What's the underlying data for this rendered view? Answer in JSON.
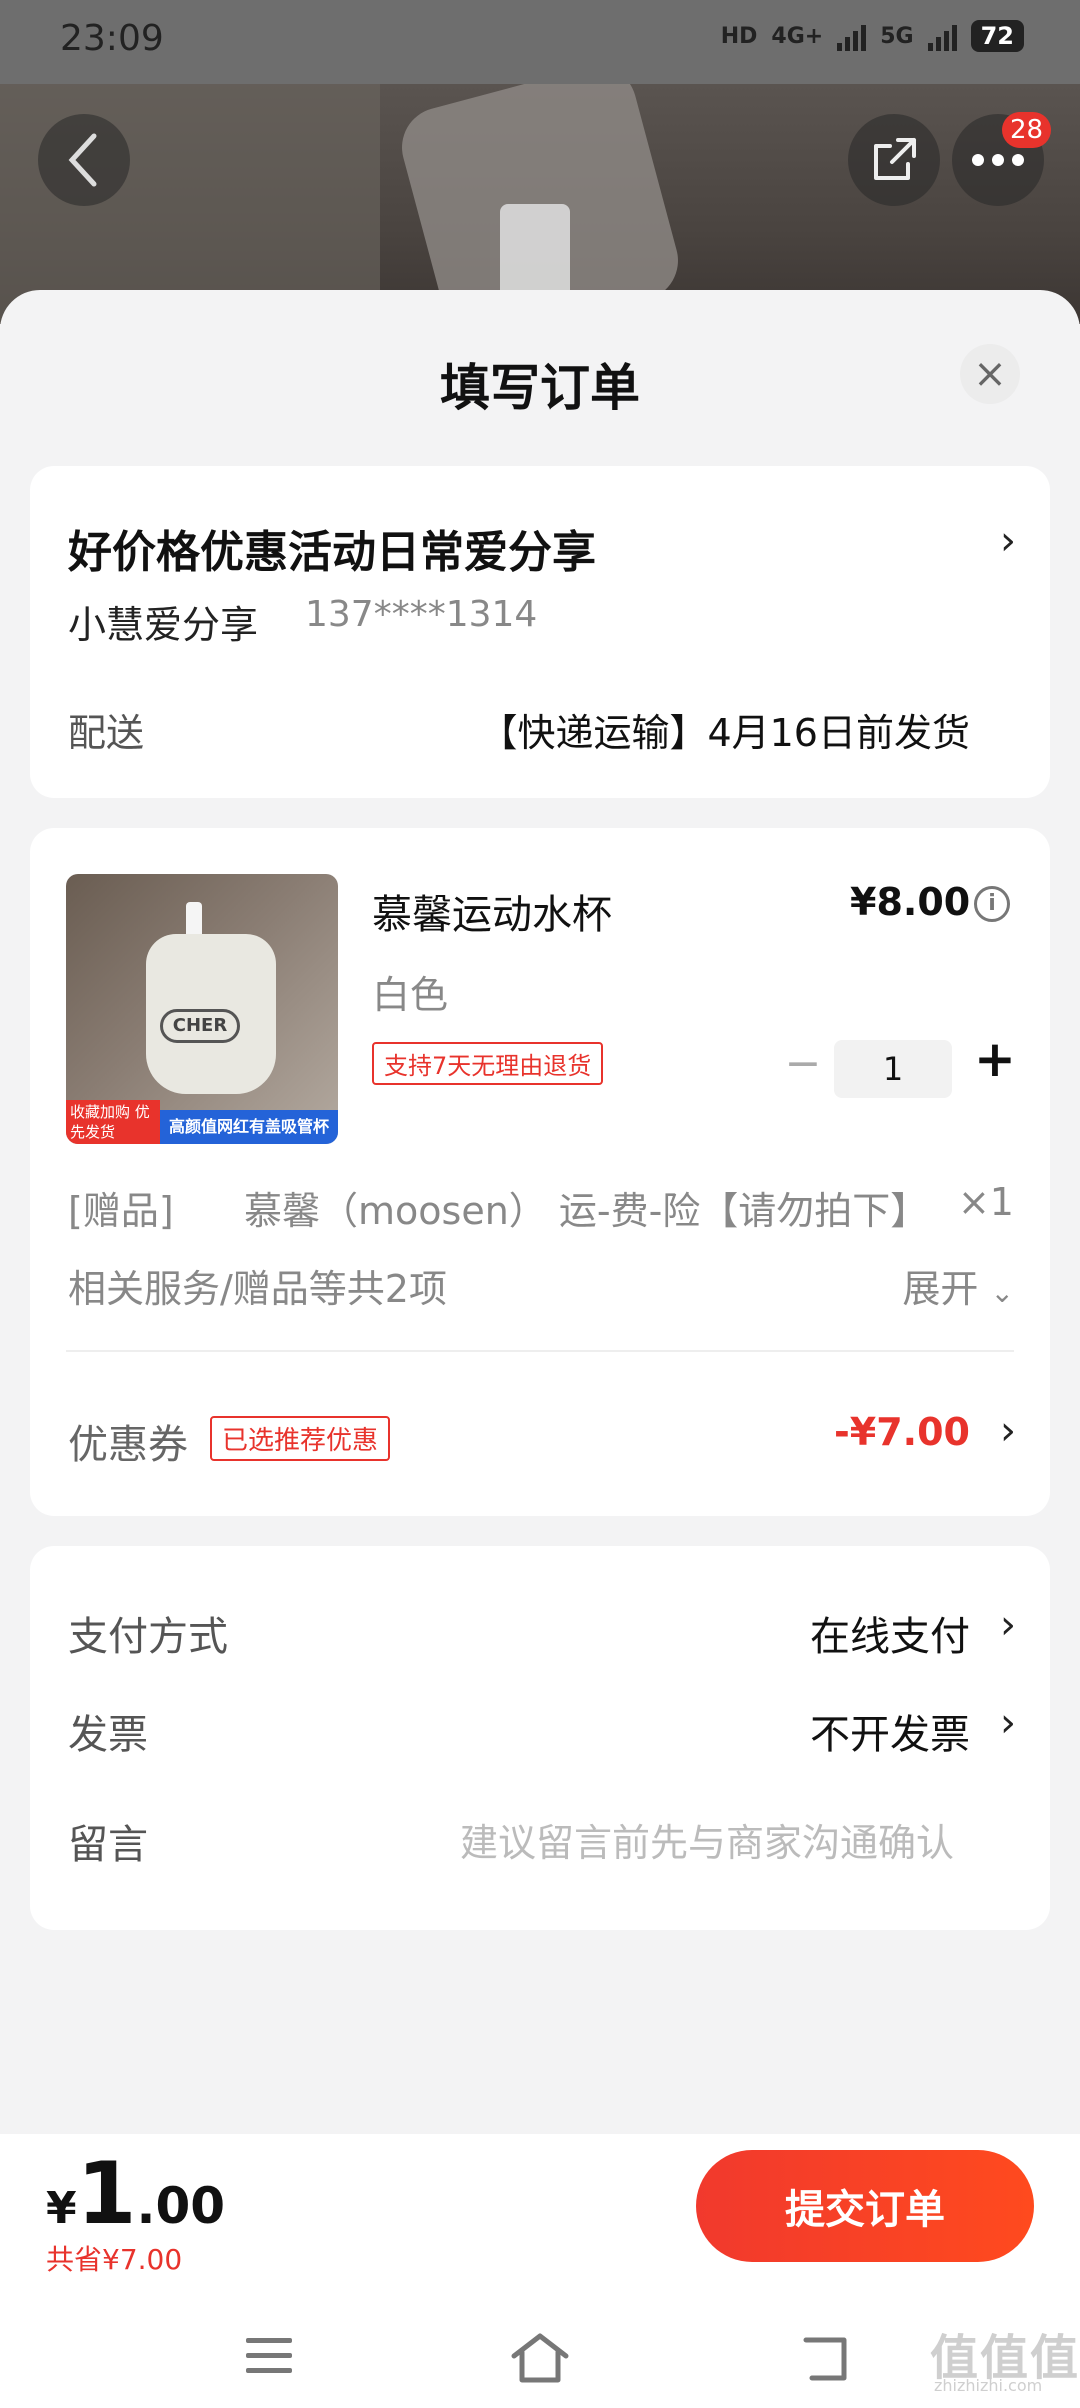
{
  "status_bar": {
    "time": "23:09",
    "network1": "HD",
    "network2": "4G+",
    "network3": "5G",
    "battery": "72"
  },
  "header": {
    "more_badge": "28"
  },
  "sheet": {
    "title": "填写订单",
    "close": "×"
  },
  "address": {
    "title": "好价格优惠活动日常爱分享",
    "name": "小慧爱分享",
    "phone": "137****1314",
    "shipping_label": "配送",
    "shipping_value": "【快递运输】4月16日前发货"
  },
  "product": {
    "name": "慕馨运动水杯",
    "price": "¥8.00",
    "spec": "白色",
    "return_tag": "支持7天无理由退货",
    "quantity": "1",
    "image_tag_red": "收藏加购 优先发货",
    "image_tag_blue": "高颜值网红有盖吸管杯",
    "image_cup_label": "CHER"
  },
  "gift": {
    "label": "[赠品]",
    "name": "慕馨（moosen） 运-费-险【请勿拍下】",
    "qty": "×1"
  },
  "services": {
    "label": "相关服务/赠品等共2项",
    "expand": "展开"
  },
  "coupon": {
    "label": "优惠券",
    "tag": "已选推荐优惠",
    "value": "-¥7.00"
  },
  "payment": {
    "label": "支付方式",
    "value": "在线支付"
  },
  "invoice": {
    "label": "发票",
    "value": "不开发票"
  },
  "message": {
    "label": "留言",
    "placeholder": "建议留言前先与商家沟通确认"
  },
  "footer": {
    "currency": "¥",
    "total_int": "1",
    "total_dec": ".00",
    "saved": "共省¥7.00",
    "submit": "提交订单"
  },
  "watermark": {
    "text": "值值值",
    "sub": "zhizhizhi.com"
  },
  "colors": {
    "accent": "#e8332c",
    "submit_gradient_end": "#ff4a1e"
  }
}
